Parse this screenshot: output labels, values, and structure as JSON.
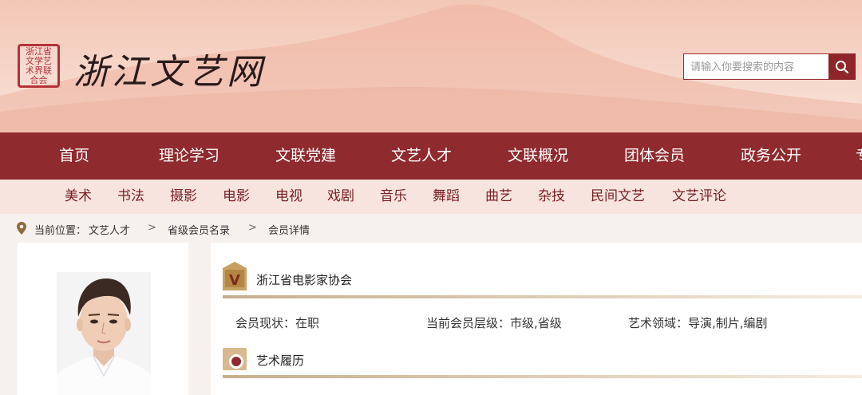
{
  "header": {
    "seal_text": "浙江省文学艺术界联合会",
    "site_title": "浙江文艺网"
  },
  "search": {
    "placeholder": "请输入你要搜索的内容",
    "icon": "search-icon"
  },
  "nav": {
    "items": [
      "首页",
      "理论学习",
      "文联党建",
      "文艺人才",
      "文联概况",
      "团体会员",
      "政务公开",
      "专"
    ]
  },
  "subnav": {
    "items": [
      "美术",
      "书法",
      "摄影",
      "电影",
      "电视",
      "戏剧",
      "音乐",
      "舞蹈",
      "曲艺",
      "杂技",
      "民间文艺",
      "文艺评论"
    ]
  },
  "breadcrumb": {
    "prefix": "当前位置：",
    "items": [
      "文艺人才",
      "省级会员名录",
      "会员详情"
    ],
    "separator": ">"
  },
  "member": {
    "association": "浙江省电影家协会",
    "status_label": "会员现状：",
    "status_value": "在职",
    "level_label": "当前会员层级：",
    "level_value": "市级,省级",
    "field_label": "艺术领域：",
    "field_value": "导演,制片,编剧",
    "resume_title": "艺术履历",
    "badge_letter": "V"
  },
  "colors": {
    "brand": "#8f2a2e",
    "subnav_bg": "#f7e4de",
    "subnav_text": "#7a1f24",
    "accent_gold": "#c8ae8e"
  }
}
